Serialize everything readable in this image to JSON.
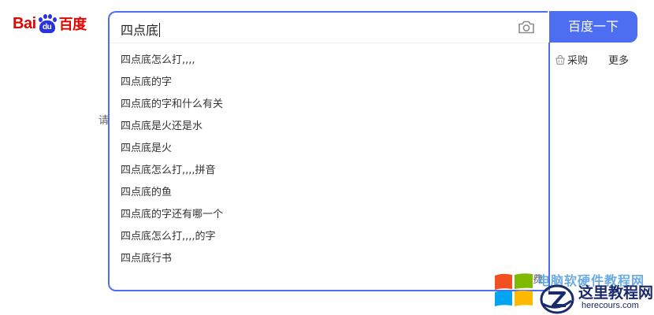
{
  "logo": {
    "text_left": "Bai",
    "text_paw": "du",
    "text_cn": "百度"
  },
  "search": {
    "query": "四点底",
    "button_label": "百度一下",
    "suggestions": [
      "四点底怎么打,,,,",
      "四点底的字",
      "四点底的字和什么有关",
      "四点底是火还是水",
      "四点底是火",
      "四点底怎么打,,,,拼音",
      "四点底的鱼",
      "四点底的字还有哪一个",
      "四点底怎么打,,,,的字",
      "四点底行书"
    ]
  },
  "links": {
    "purchase": "采购",
    "more": "更多"
  },
  "partial_text": {
    "left_char": "请",
    "bottom_char": "费"
  },
  "watermark": {
    "top_text": "电脑软硬件教程网",
    "title": "这里教程网",
    "url": "herecours.com"
  },
  "colors": {
    "accent": "#4e6ef2",
    "logo_red": "#e10601",
    "logo_blue": "#2932e1"
  }
}
